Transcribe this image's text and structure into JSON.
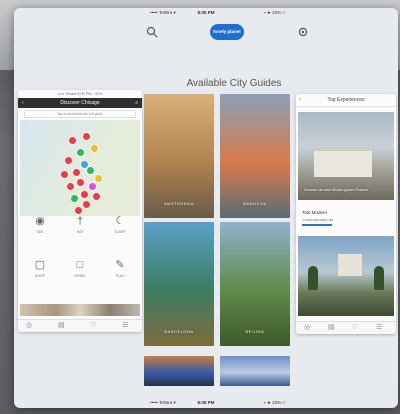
{
  "status_bar": {
    "carrier": "••••• Telstra ▾",
    "time": "8:05 PM",
    "battery": "▪ ★ 33% □"
  },
  "header": {
    "logo_text": "lonely planet",
    "search_icon": "search-icon",
    "settings_icon": "gear-icon"
  },
  "page": {
    "title": "Available City Guides"
  },
  "left_card": {
    "mini_status": "••••• Telstra   8:05 PM   ▪ 33%",
    "header_title": "Discover Chicago",
    "back_glyph": "‹",
    "search_glyph": "⌕",
    "notice": "Tap to download the full guide",
    "map_colors": [
      "#e33e4b",
      "#e33e4b",
      "#35b35b",
      "#e8c12d",
      "#e33e4b",
      "#4aa3d9",
      "#e33e4b",
      "#35b35b",
      "#e33e4b",
      "#e8c12d",
      "#e33e4b",
      "#e33e4b",
      "#c65bd1",
      "#e33e4b",
      "#35b35b",
      "#e33e4b",
      "#e33e4b",
      "#e33e4b"
    ],
    "icons": [
      {
        "name": "see-icon",
        "glyph": "◉",
        "label": "SEE"
      },
      {
        "name": "eat-icon",
        "glyph": "†",
        "label": "EAT"
      },
      {
        "name": "sleep-icon",
        "glyph": "☾",
        "label": "SLEEP"
      },
      {
        "name": "shop-icon",
        "glyph": "▢",
        "label": "SHOP"
      },
      {
        "name": "drink-icon",
        "glyph": "□",
        "label": "DRINK"
      },
      {
        "name": "play-icon",
        "glyph": "✎",
        "label": "PLAY"
      }
    ],
    "tabs": [
      "◎",
      "▤",
      "♡",
      "☰"
    ]
  },
  "cities": [
    {
      "name": "AMSTERDAM",
      "colors": [
        "#d9b07a",
        "#b0824f",
        "#6b5c4a"
      ]
    },
    {
      "name": "BANGKOK",
      "colors": [
        "#8aa0b8",
        "#d87b49",
        "#5c6b78"
      ]
    },
    {
      "name": "BARCELONA",
      "colors": [
        "#5aa0c8",
        "#3c7d63",
        "#7d6b3d"
      ]
    },
    {
      "name": "BEIJING",
      "colors": [
        "#8fb2cf",
        "#5f8a49",
        "#3d5a2c"
      ]
    },
    {
      "name": "",
      "colors": [
        "#c77e3c",
        "#3a5ca8",
        "#2a2f4a"
      ]
    },
    {
      "name": "",
      "colors": [
        "#6e8fc9",
        "#b9cbe2",
        "#3e5a8b"
      ]
    }
  ],
  "right_card": {
    "header_title": "Top Experiences",
    "back_glyph": "‹",
    "caption": "Wander around Buckingham Palace",
    "info_title": "Tate Modern",
    "info_sub": "Contemporary art",
    "tabs": [
      "◎",
      "▤",
      "♡",
      "☰"
    ]
  }
}
